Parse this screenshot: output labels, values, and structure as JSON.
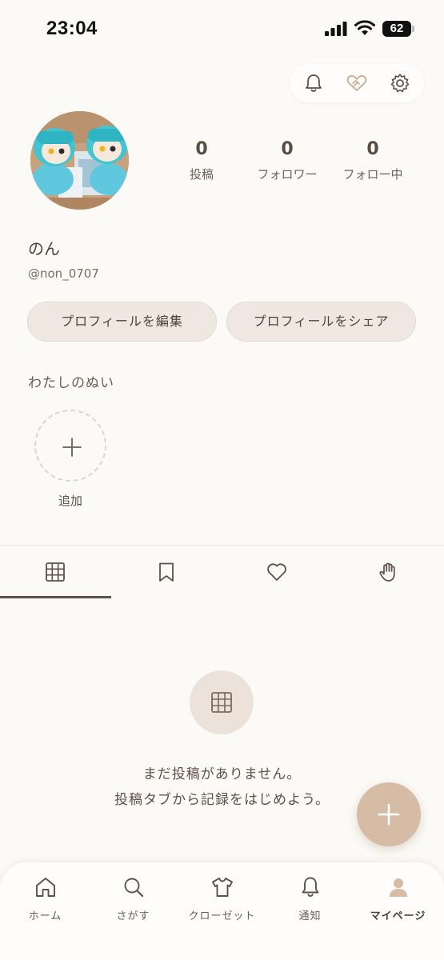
{
  "status_bar": {
    "time": "23:04",
    "battery": "62"
  },
  "header": {
    "icons": [
      "bell-icon",
      "handshake-heart-icon",
      "gear-icon"
    ]
  },
  "profile": {
    "name": "のん",
    "handle": "@non_0707",
    "stats": [
      {
        "value": "0",
        "label": "投稿"
      },
      {
        "value": "0",
        "label": "フォロワー"
      },
      {
        "value": "0",
        "label": "フォロー中"
      }
    ],
    "edit_button": "プロフィールを編集",
    "share_button": "プロフィールをシェア"
  },
  "nui_section": {
    "title": "わたしのぬい",
    "add_label": "追加"
  },
  "tabs": [
    {
      "icon": "grid-icon",
      "active": true
    },
    {
      "icon": "bookmark-icon",
      "active": false
    },
    {
      "icon": "heart-icon",
      "active": false
    },
    {
      "icon": "hand-icon",
      "active": false
    }
  ],
  "empty_state": {
    "line1": "まだ投稿がありません。",
    "line2": "投稿タブから記録をはじめよう。"
  },
  "bottom_nav": [
    {
      "label": "ホーム",
      "icon": "home-icon"
    },
    {
      "label": "さがす",
      "icon": "search-icon"
    },
    {
      "label": "クローゼット",
      "icon": "shirt-icon"
    },
    {
      "label": "通知",
      "icon": "bell-icon"
    },
    {
      "label": "マイページ",
      "icon": "person-icon",
      "active": true
    }
  ],
  "colors": {
    "background": "#fcfaf7",
    "text": "#5e5147",
    "button_bg": "#efe8e1",
    "accent": "#d6bca4"
  }
}
